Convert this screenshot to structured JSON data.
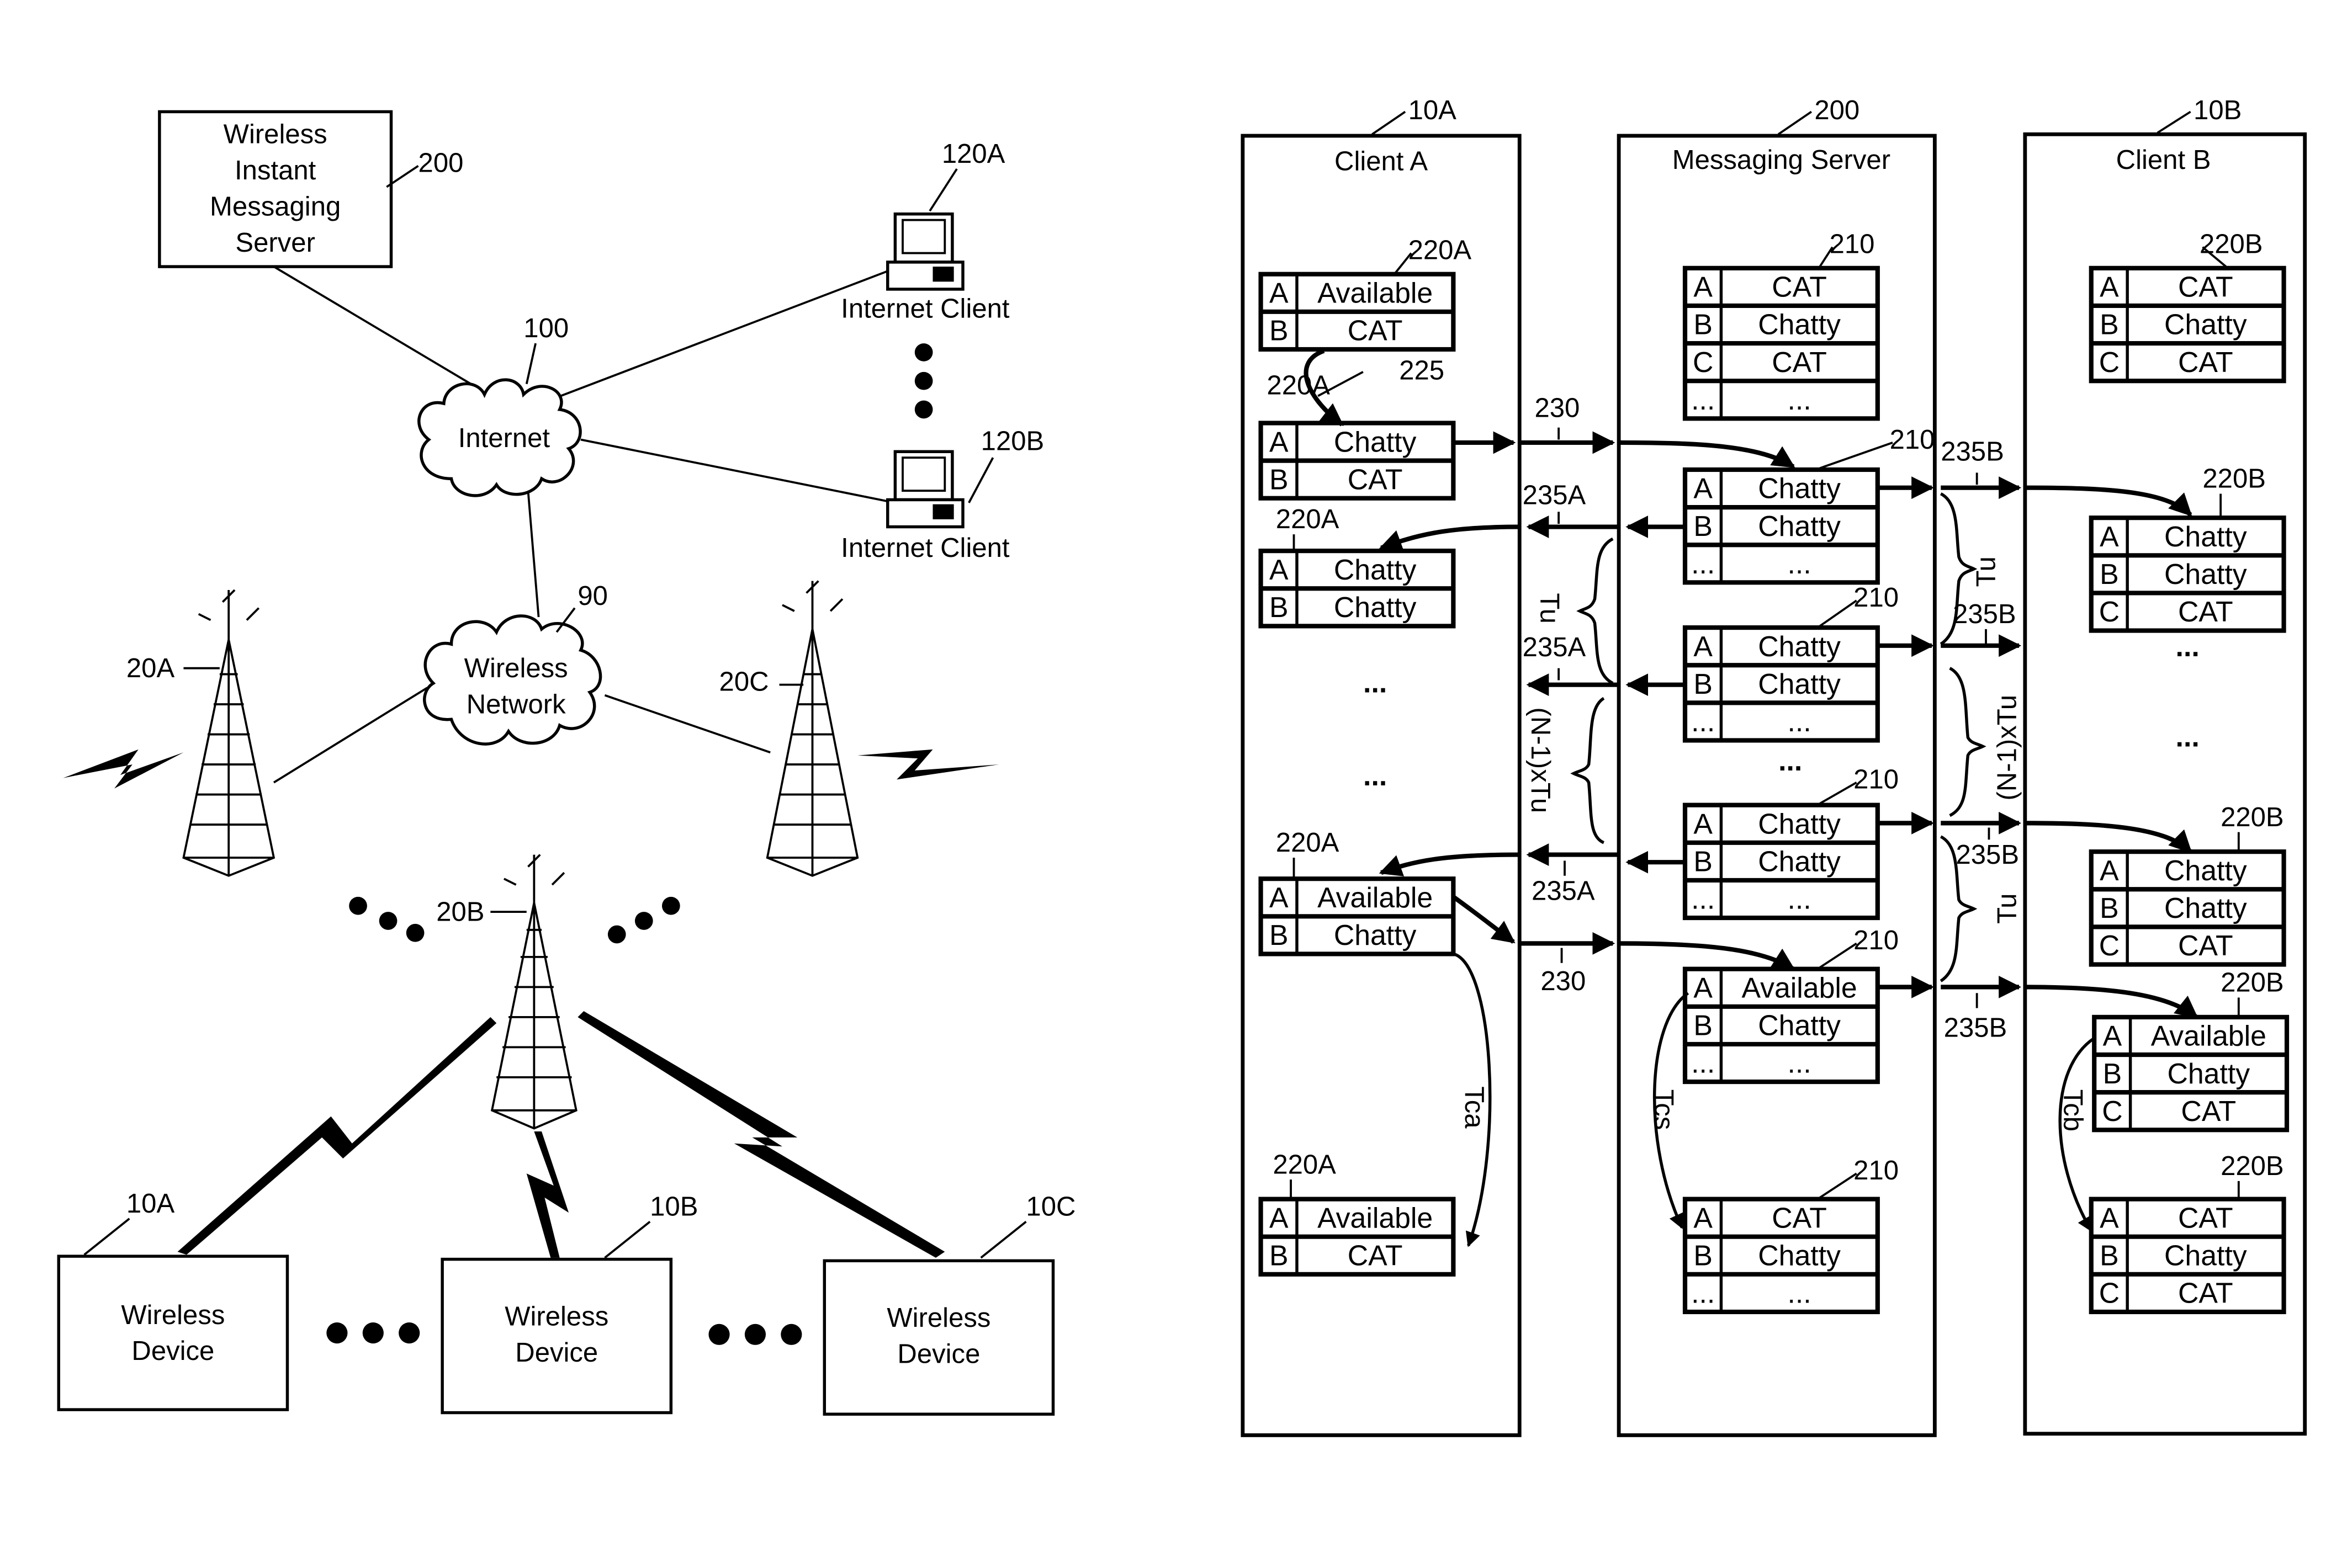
{
  "left_diagram": {
    "server": {
      "lines": [
        "Wireless",
        "Instant",
        "Messaging",
        "Server"
      ],
      "ref": "200"
    },
    "internet": {
      "label": "Internet",
      "ref": "100"
    },
    "wireless_network": {
      "lines": [
        "Wireless",
        "Network"
      ],
      "ref": "90"
    },
    "internet_clients": [
      {
        "label": "Internet Client",
        "ref": "120A"
      },
      {
        "label": "Internet Client",
        "ref": "120B"
      }
    ],
    "towers": [
      {
        "ref": "20A"
      },
      {
        "ref": "20B"
      },
      {
        "ref": "20C"
      }
    ],
    "devices": [
      {
        "lines": [
          "Wireless",
          "Device"
        ],
        "ref": "10A"
      },
      {
        "lines": [
          "Wireless",
          "Device"
        ],
        "ref": "10B"
      },
      {
        "lines": [
          "Wireless",
          "Device"
        ],
        "ref": "10C"
      }
    ]
  },
  "right_diagram": {
    "columns": [
      {
        "title": "Client A",
        "ref": "10A"
      },
      {
        "title": "Messaging Server",
        "ref": "200"
      },
      {
        "title": "Client B",
        "ref": "10B"
      }
    ],
    "client_a_tables": [
      {
        "ref": "220A",
        "rows": [
          [
            "A",
            "Available"
          ],
          [
            "B",
            "CAT"
          ]
        ]
      },
      {
        "ref": "220A",
        "rows": [
          [
            "A",
            "Chatty"
          ],
          [
            "B",
            "CAT"
          ]
        ]
      },
      {
        "ref": "220A",
        "rows": [
          [
            "A",
            "Chatty"
          ],
          [
            "B",
            "Chatty"
          ]
        ]
      },
      {
        "ref": "220A",
        "rows": [
          [
            "A",
            "Available"
          ],
          [
            "B",
            "Chatty"
          ]
        ]
      },
      {
        "ref": "220A",
        "rows": [
          [
            "A",
            "Available"
          ],
          [
            "B",
            "CAT"
          ]
        ]
      }
    ],
    "server_tables": [
      {
        "ref": "210",
        "rows": [
          [
            "A",
            "CAT"
          ],
          [
            "B",
            "Chatty"
          ],
          [
            "C",
            "CAT"
          ],
          [
            "...",
            "..."
          ]
        ]
      },
      {
        "ref": "210",
        "rows": [
          [
            "A",
            "Chatty"
          ],
          [
            "B",
            "Chatty"
          ],
          [
            "...",
            "..."
          ]
        ]
      },
      {
        "ref": "210",
        "rows": [
          [
            "A",
            "Chatty"
          ],
          [
            "B",
            "Chatty"
          ],
          [
            "...",
            "..."
          ]
        ]
      },
      {
        "ref": "210",
        "rows": [
          [
            "A",
            "Chatty"
          ],
          [
            "B",
            "Chatty"
          ],
          [
            "...",
            "..."
          ]
        ]
      },
      {
        "ref": "210",
        "rows": [
          [
            "A",
            "Available"
          ],
          [
            "B",
            "Chatty"
          ],
          [
            "...",
            "..."
          ]
        ]
      },
      {
        "ref": "210",
        "rows": [
          [
            "A",
            "CAT"
          ],
          [
            "B",
            "Chatty"
          ],
          [
            "...",
            "..."
          ]
        ]
      }
    ],
    "client_b_tables": [
      {
        "ref": "220B",
        "rows": [
          [
            "A",
            "CAT"
          ],
          [
            "B",
            "Chatty"
          ],
          [
            "C",
            "CAT"
          ]
        ]
      },
      {
        "ref": "220B",
        "rows": [
          [
            "A",
            "Chatty"
          ],
          [
            "B",
            "Chatty"
          ],
          [
            "C",
            "CAT"
          ]
        ]
      },
      {
        "ref": "220B",
        "rows": [
          [
            "A",
            "Chatty"
          ],
          [
            "B",
            "Chatty"
          ],
          [
            "C",
            "CAT"
          ]
        ]
      },
      {
        "ref": "220B",
        "rows": [
          [
            "A",
            "Available"
          ],
          [
            "B",
            "Chatty"
          ],
          [
            "C",
            "CAT"
          ]
        ]
      },
      {
        "ref": "220B",
        "rows": [
          [
            "A",
            "CAT"
          ],
          [
            "B",
            "Chatty"
          ],
          [
            "C",
            "CAT"
          ]
        ]
      }
    ],
    "labels": {
      "change": "225",
      "update_msg": "230",
      "notify_a": "235A",
      "notify_b": "235B",
      "tu": "Tu",
      "n_minus_1_tu": "(N-1)xTu",
      "tca": "Tca",
      "tcs": "Tcs",
      "tcb": "Tcb",
      "ellipsis": "..."
    }
  }
}
